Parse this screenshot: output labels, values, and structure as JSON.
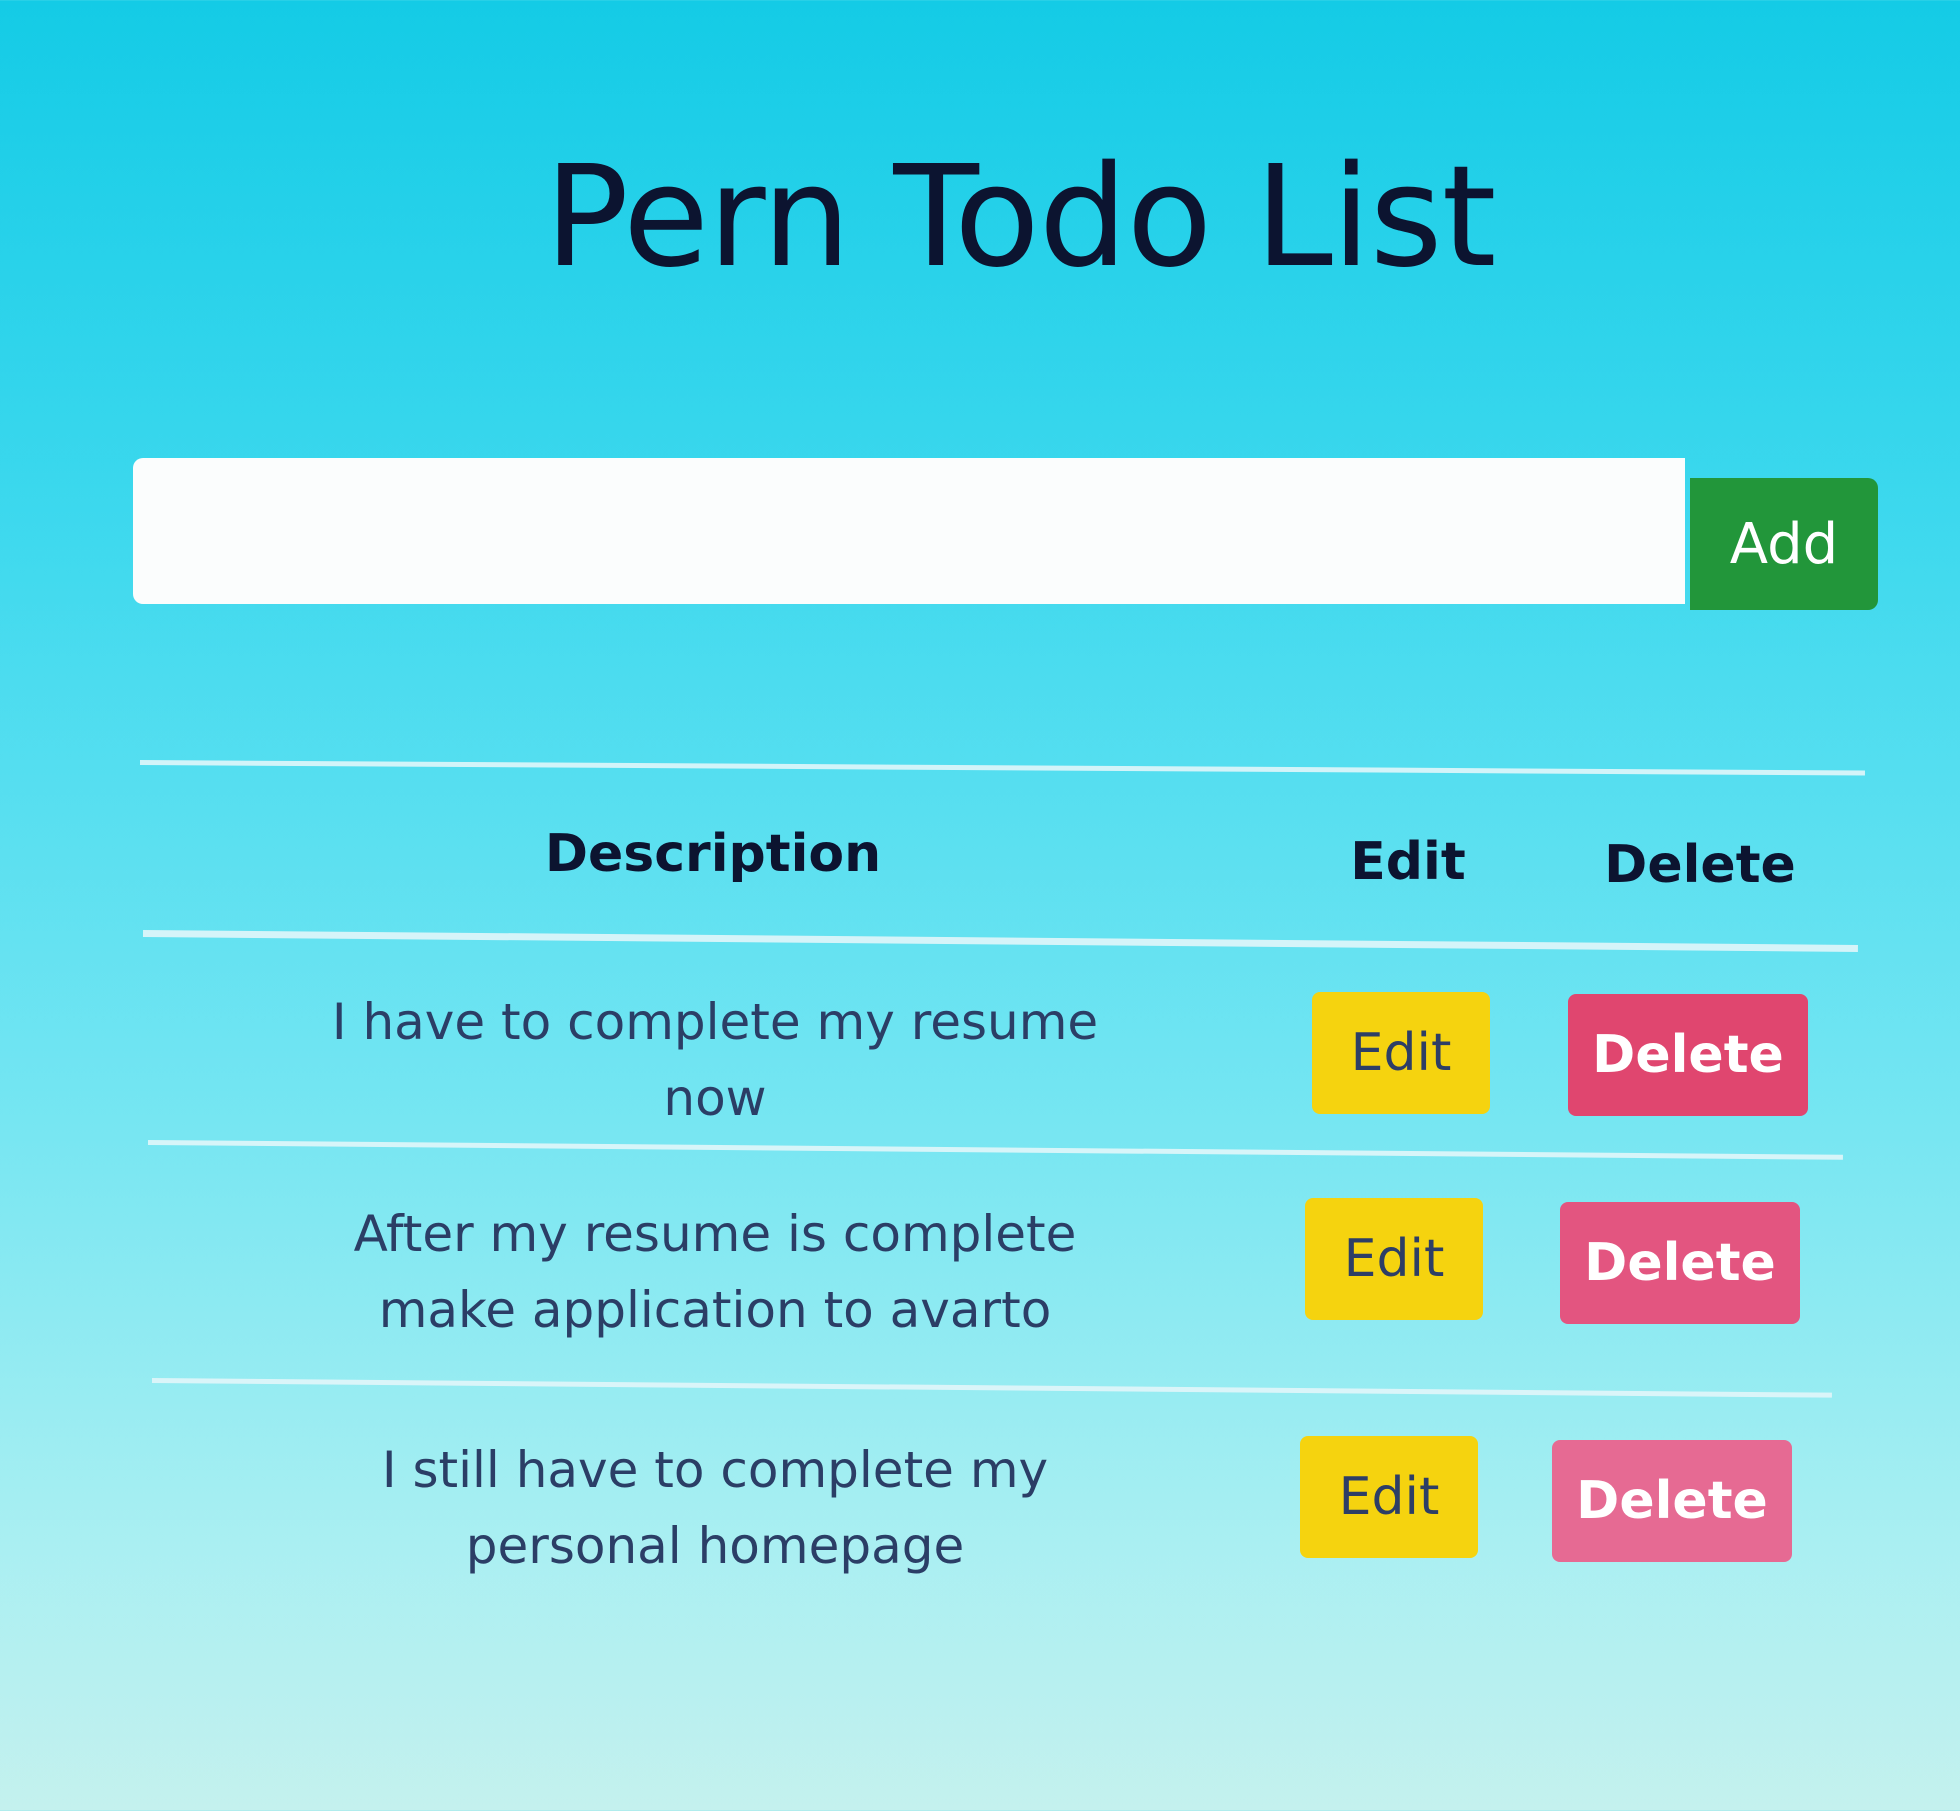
{
  "title": "Pern Todo List",
  "input": {
    "value": "",
    "placeholder": ""
  },
  "add_label": "Add",
  "table": {
    "headers": [
      "Description",
      "Edit",
      "Delete"
    ],
    "rows": [
      {
        "description": "I have to complete my resume now",
        "edit_label": "Edit",
        "delete_label": "Delete"
      },
      {
        "description": "After my resume is complete make application to avarto",
        "edit_label": "Edit",
        "delete_label": "Delete"
      },
      {
        "description": "I still have to complete my personal homepage",
        "edit_label": "Edit",
        "delete_label": "Delete"
      }
    ]
  },
  "colors": {
    "add": "#22963a",
    "edit": "#f5d30f",
    "delete": "#e0466f"
  }
}
